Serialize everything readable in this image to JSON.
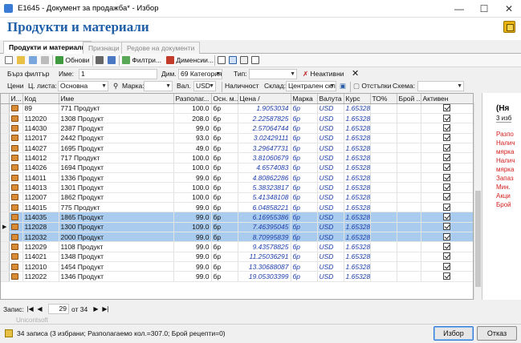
{
  "window": {
    "title": "E1645 - Документ за продажба* - Избор",
    "minimize": "—",
    "maximize": "☐",
    "close": "✕"
  },
  "page": {
    "title": "Продукти и материали"
  },
  "tabs": [
    {
      "label": "Продукти и материали"
    },
    {
      "label": "Признаци"
    },
    {
      "label": "Редове на документи"
    }
  ],
  "toolbar": {
    "refresh_label": "Обнови",
    "filters_label": "Филтри...",
    "dimensions_label": "Дименсии..."
  },
  "filter_row1": {
    "quick_filter_label": "Бърз филтър",
    "name_label": "Име:",
    "name_value": "1",
    "dim_label": "Дим.",
    "dim_value": "69 Категория",
    "type_label": "Тип:",
    "type_value": "",
    "inactive_label": "Неактивни"
  },
  "filter_row2": {
    "prices_label": "Цени",
    "pricelist_label": "Ц. листа:",
    "pricelist_value": "Основна",
    "brand_label": "Марка:",
    "brand_value": "",
    "currency_label": "Вал.",
    "currency_value": "USD",
    "availability_label": "Наличност",
    "warehouse_label": "Склад:",
    "warehouse_value": "Централен скл",
    "discounts_label": "Отстъпки",
    "scheme_label": "Схема:",
    "scheme_value": ""
  },
  "table": {
    "columns": [
      "И...",
      "Код",
      "Име",
      "Разполаг...",
      "Осн. м...",
      "Цена /",
      "Марка",
      "Валута",
      "Курс",
      "ТО%",
      "Брой ...",
      "Активен"
    ],
    "rows": [
      {
        "code": "89",
        "name": "771 Продукт",
        "avail": "100.0",
        "unit": "бр",
        "price": "1.9053034",
        "brand": "бр",
        "currency": "USD",
        "rate": "1.65328",
        "selected": false,
        "current": false
      },
      {
        "code": "112020",
        "name": "1308 Продукт",
        "avail": "208.0",
        "unit": "бр",
        "price": "2.22587825",
        "brand": "бр",
        "currency": "USD",
        "rate": "1.65328",
        "selected": false,
        "current": false
      },
      {
        "code": "114030",
        "name": "2387 Продукт",
        "avail": "99.0",
        "unit": "бр",
        "price": "2.57064744",
        "brand": "бр",
        "currency": "USD",
        "rate": "1.65328",
        "selected": false,
        "current": false
      },
      {
        "code": "112017",
        "name": "2442 Продукт",
        "avail": "93.0",
        "unit": "бр",
        "price": "3.02429111",
        "brand": "бр",
        "currency": "USD",
        "rate": "1.65328",
        "selected": false,
        "current": false
      },
      {
        "code": "114027",
        "name": "1695 Продукт",
        "avail": "49.0",
        "unit": "бр",
        "price": "3.29647731",
        "brand": "бр",
        "currency": "USD",
        "rate": "1.65328",
        "selected": false,
        "current": false
      },
      {
        "code": "114012",
        "name": "717 Продукт",
        "avail": "100.0",
        "unit": "бр",
        "price": "3.81060679",
        "brand": "бр",
        "currency": "USD",
        "rate": "1.65328",
        "selected": false,
        "current": false
      },
      {
        "code": "114026",
        "name": "1694 Продукт",
        "avail": "100.0",
        "unit": "бр",
        "price": "4.6574083",
        "brand": "бр",
        "currency": "USD",
        "rate": "1.65328",
        "selected": false,
        "current": false
      },
      {
        "code": "114011",
        "name": "1336 Продукт",
        "avail": "99.0",
        "unit": "бр",
        "price": "4.80862286",
        "brand": "бр",
        "currency": "USD",
        "rate": "1.65328",
        "selected": false,
        "current": false
      },
      {
        "code": "114013",
        "name": "1301 Продукт",
        "avail": "100.0",
        "unit": "бр",
        "price": "5.38323817",
        "brand": "бр",
        "currency": "USD",
        "rate": "1.65328",
        "selected": false,
        "current": false
      },
      {
        "code": "112007",
        "name": "1862 Продукт",
        "avail": "100.0",
        "unit": "бр",
        "price": "5.41348108",
        "brand": "бр",
        "currency": "USD",
        "rate": "1.65328",
        "selected": false,
        "current": false
      },
      {
        "code": "114015",
        "name": "775 Продукт",
        "avail": "99.0",
        "unit": "бр",
        "price": "6.04858221",
        "brand": "бр",
        "currency": "USD",
        "rate": "1.65328",
        "selected": false,
        "current": false
      },
      {
        "code": "114035",
        "name": "1865 Продукт",
        "avail": "99.0",
        "unit": "бр",
        "price": "6.16955386",
        "brand": "бр",
        "currency": "USD",
        "rate": "1.65328",
        "selected": true,
        "current": false
      },
      {
        "code": "112028",
        "name": "1300 Продукт",
        "avail": "109.0",
        "unit": "бр",
        "price": "7.46395045",
        "brand": "бр",
        "currency": "USD",
        "rate": "1.65328",
        "selected": true,
        "current": true
      },
      {
        "code": "112032",
        "name": "2000 Продукт",
        "avail": "99.0",
        "unit": "бр",
        "price": "8.70995839",
        "brand": "бр",
        "currency": "USD",
        "rate": "1.65328",
        "selected": true,
        "current": false
      },
      {
        "code": "112029",
        "name": "1108 Продукт",
        "avail": "99.0",
        "unit": "бр",
        "price": "9.43578825",
        "brand": "бр",
        "currency": "USD",
        "rate": "1.65328",
        "selected": false,
        "current": false
      },
      {
        "code": "114021",
        "name": "1348 Продукт",
        "avail": "99.0",
        "unit": "бр",
        "price": "11.25036291",
        "brand": "бр",
        "currency": "USD",
        "rate": "1.65328",
        "selected": false,
        "current": false
      },
      {
        "code": "112010",
        "name": "1454 Продукт",
        "avail": "99.0",
        "unit": "бр",
        "price": "13.30688087",
        "brand": "бр",
        "currency": "USD",
        "rate": "1.65328",
        "selected": false,
        "current": false
      },
      {
        "code": "112022",
        "name": "1346 Продукт",
        "avail": "99.0",
        "unit": "бр",
        "price": "19.05303399",
        "brand": "бр",
        "currency": "USD",
        "rate": "1.65328",
        "selected": false,
        "current": false
      }
    ]
  },
  "side_panel": {
    "title": "(Ня",
    "subtitle": "3 изб",
    "lines": [
      "Разпо",
      "Налич",
      "мярка",
      "Налич",
      "мярка",
      "Запаз",
      "Мин.",
      "Акци",
      "Брой"
    ]
  },
  "navigator": {
    "label": "Запис:",
    "current": "29",
    "of_label": "от 34"
  },
  "footer": {
    "brand": "Unicontsoft",
    "status": "34 записа (3 избрани; Разполагаемо кол.=307.0; Брой рецепти=0)",
    "select_label": "Избор",
    "cancel_label": "Отказ"
  },
  "colors": {
    "accent": "#1f5fa8",
    "selected_row": "#a9cbee",
    "price_text": "#1e3faa",
    "side_red": "#d42020"
  }
}
